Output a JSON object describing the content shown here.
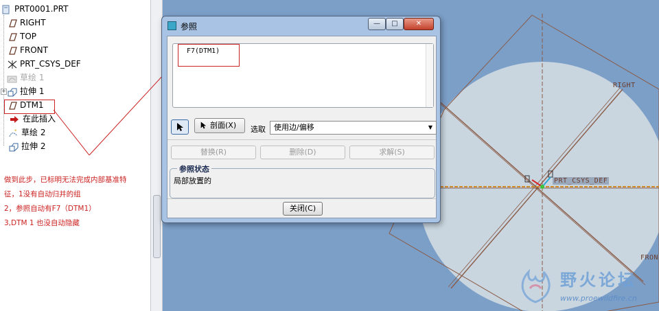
{
  "tree": {
    "root": "PRT0001.PRT",
    "items": [
      {
        "label": "RIGHT",
        "icon": "datum-plane-icon",
        "state": "normal"
      },
      {
        "label": "TOP",
        "icon": "datum-plane-icon",
        "state": "normal"
      },
      {
        "label": "FRONT",
        "icon": "datum-plane-icon",
        "state": "normal"
      },
      {
        "label": "PRT_CSYS_DEF",
        "icon": "csys-icon",
        "state": "normal"
      },
      {
        "label": "草绘 1",
        "icon": "sketch-icon",
        "state": "suppressed"
      },
      {
        "label": "拉伸 1",
        "icon": "extrude-icon",
        "state": "expandable"
      },
      {
        "label": "DTM1",
        "icon": "datum-plane-icon",
        "state": "marked"
      },
      {
        "label": "在此插入",
        "icon": "insert-here-icon",
        "state": "normal"
      },
      {
        "label": "草绘 2",
        "icon": "sketch-icon",
        "state": "new"
      },
      {
        "label": "拉伸 2",
        "icon": "extrude-icon",
        "state": "new"
      }
    ]
  },
  "annotation": {
    "lines": [
      "做到此步，已标明无法完成内部基准特",
      "征，1没有自动归并的组",
      "2，参照自动有F7（DTM1）",
      "3,DTM 1 也没自动隐藏"
    ],
    "color": "#cc2222"
  },
  "dialog": {
    "title": "参照",
    "window_controls": {
      "minimize": "—",
      "maximize": "□",
      "close": "✕"
    },
    "reference_item": "F7(DTM1)",
    "section_button": "剖面(X)",
    "select_label": "选取",
    "select_value": "使用边/偏移",
    "buttons": {
      "replace": "替换(R)",
      "delete": "删除(D)",
      "solve": "求解(S)"
    },
    "status_title": "参照状态",
    "status_value": "局部放置的",
    "close_button": "关闭(C)"
  },
  "viewport": {
    "labels": {
      "right": "RIGHT",
      "csys": "PRT_CSYS_DEF",
      "front": "FRON"
    },
    "background": "#7c9fc8"
  },
  "watermark": {
    "title": "野火论坛",
    "url": "www.proewildfire.cn"
  }
}
